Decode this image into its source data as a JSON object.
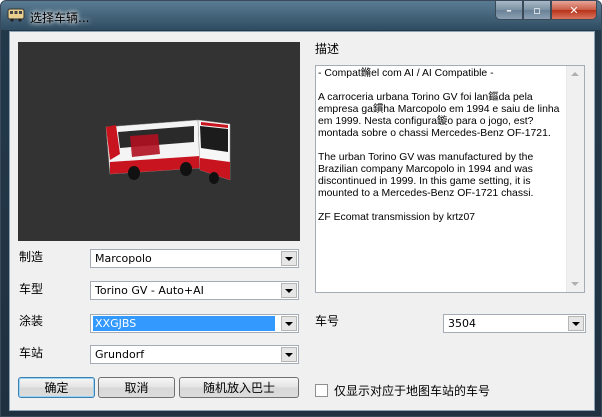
{
  "window": {
    "title": "选择车辆..."
  },
  "caption_buttons": {
    "min": "–",
    "max": "▫",
    "close": "✕"
  },
  "colors": {
    "titlebar": "#2f4c61",
    "selection": "#3399ff",
    "preview_bg": "#333333"
  },
  "form": {
    "manufacturer": {
      "label": "制造",
      "value": "Marcopolo"
    },
    "model": {
      "label": "车型",
      "value": "Torino GV - Auto+AI"
    },
    "livery": {
      "label": "涂装",
      "value": "XXGJBS"
    },
    "station": {
      "label": "车站",
      "value": "Grundorf"
    },
    "bus_number": {
      "label": "车号",
      "value": "3504"
    }
  },
  "description": {
    "label": "描述",
    "text": "- Compat鏅el com AI / AI Compatible -\n\nA carroceria urbana Torino GV foi lan鏂da pela empresa ga鏆ha Marcopolo em 1994 e saiu de linha em 1999. Nesta configura鏇o para o jogo, est? montada sobre o chassi Mercedes-Benz OF-1721.\n\nThe urban Torino GV was manufactured by the Brazilian company Marcopolo in 1994 and was discontinued in 1999. In this game setting, it is mounted to a Mercedes-Benz OF-1721 chassi.\n\nZF Ecomat transmission by krtz07"
  },
  "buttons": {
    "ok": "确定",
    "cancel": "取消",
    "random": "随机放入巴士"
  },
  "checkbox": {
    "label": "仅显示对应于地图车站的车号",
    "checked": false
  }
}
